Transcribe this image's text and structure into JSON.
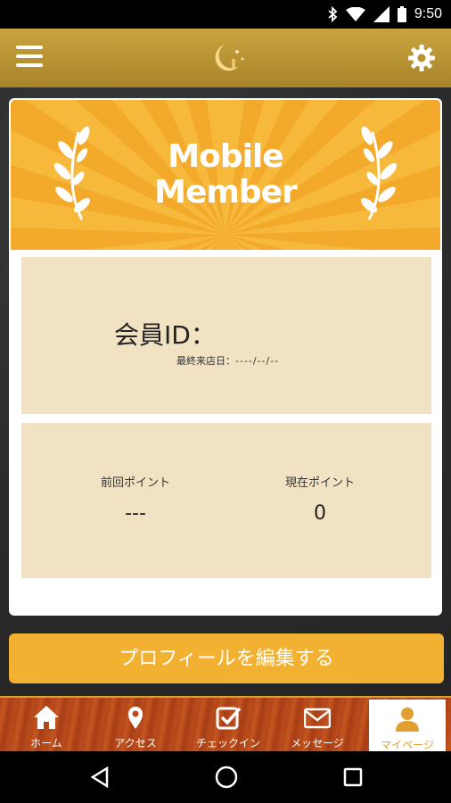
{
  "status_bar": {
    "time": "9:50"
  },
  "app_bar": {
    "logo": "crescent-moon-logo"
  },
  "banner": {
    "title_line1": "Mobile",
    "title_line2": "Member"
  },
  "member": {
    "id_label": "会員ID：",
    "last_visit_label": "最終来店日：",
    "last_visit_value": "----/--/--"
  },
  "points": {
    "previous_label": "前回ポイント",
    "previous_value": "---",
    "current_label": "現在ポイント",
    "current_value": "0"
  },
  "edit_profile_label": "プロフィールを編集する",
  "tabs": [
    {
      "label": "ホーム",
      "icon": "home-icon"
    },
    {
      "label": "アクセス",
      "icon": "map-pin-icon"
    },
    {
      "label": "チェックイン",
      "icon": "checkbox-icon"
    },
    {
      "label": "メッセージ",
      "icon": "envelope-icon"
    },
    {
      "label": "マイページ",
      "icon": "person-icon",
      "active": true
    }
  ],
  "colors": {
    "accent": "#f2b130",
    "header": "#b8922f",
    "panel": "#f1e2c4",
    "tabbar": "#b84a1b"
  }
}
